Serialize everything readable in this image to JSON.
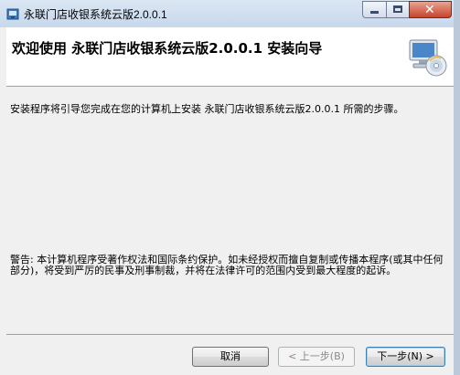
{
  "window": {
    "title": "永联门店收银系统云版2.0.0.1",
    "controls": {
      "minimize": "minimize",
      "maximize": "maximize",
      "close": "✕"
    }
  },
  "header": {
    "title": "欢迎使用 永联门店收银系统云版2.0.0.1 安装向导",
    "icon": "setup-disc-computer-icon"
  },
  "content": {
    "intro": "安装程序将引导您完成在您的计算机上安装 永联门店收银系统云版2.0.0.1 所需的步骤。",
    "warning": "警告: 本计算机程序受著作权法和国际条约保护。如未经授权而擅自复制或传播本程序(或其中任何部分)，将受到严厉的民事及刑事制裁，并将在法律许可的范围内受到最大程度的起诉。"
  },
  "buttons": {
    "cancel": "取消",
    "back": "< 上一步(B)",
    "next": "下一步(N) >"
  }
}
